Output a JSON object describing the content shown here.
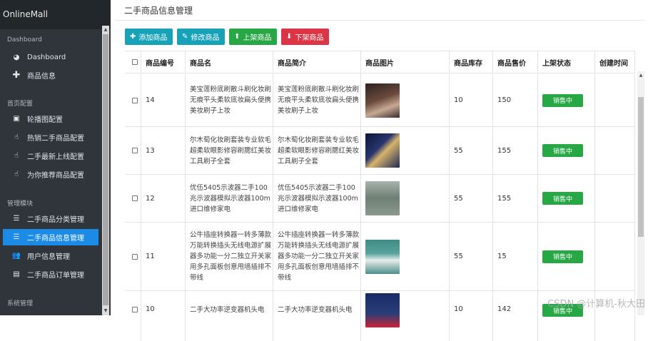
{
  "app": {
    "title": "OnlineMall"
  },
  "sidebar": {
    "sections": [
      {
        "label": "Dashboard"
      },
      {
        "label": "首页配置"
      },
      {
        "label": "管理模块"
      },
      {
        "label": "系统管理"
      }
    ],
    "items": [
      {
        "label": "Dashboard",
        "icon": "dashboard-icon"
      },
      {
        "label": "商品信息",
        "icon": "plus-icon"
      },
      {
        "label": "轮播图配置",
        "icon": "image-icon"
      },
      {
        "label": "热销二手商品配置",
        "icon": "pointer-icon"
      },
      {
        "label": "二手最新上线配置",
        "icon": "pointer-icon"
      },
      {
        "label": "为你推荐商品配置",
        "icon": "pointer-icon"
      },
      {
        "label": "二手商品分类管理",
        "icon": "list-icon"
      },
      {
        "label": "二手商品信息管理",
        "icon": "list-icon"
      },
      {
        "label": "用户信息管理",
        "icon": "users-icon"
      },
      {
        "label": "二手商品订单管理",
        "icon": "order-icon"
      }
    ]
  },
  "main": {
    "title": "二手商品信息管理",
    "toolbar": {
      "add": "添加商品",
      "edit": "修改商品",
      "up": "上架商品",
      "down": "下架商品"
    },
    "table": {
      "headers": [
        "商品编号",
        "商品名",
        "商品简介",
        "商品图片",
        "商品库存",
        "商品售价",
        "上架状态",
        "创建时间"
      ],
      "rows": [
        {
          "id": "14",
          "name": "美宝莲粉底刷散斗刷化妆刷无痕平头柔软底妆扁头便携美妆刷子上妆",
          "intro": "美宝莲粉底刷散斗刷化妆刷无痕平头柔软底妆扁头便携美妆刷子上妆",
          "stock": "10",
          "price": "150",
          "status": "销售中",
          "img": "#3a2d2a"
        },
        {
          "id": "13",
          "name": "尔木萄化妆刷套装专业软毛超柔软眼影修容刷腮红美妆工具刷子全套",
          "intro": "尔木萄化妆刷套装专业软毛超柔软眼影修容刷腮红美妆工具刷子全套",
          "stock": "55",
          "price": "155",
          "status": "销售中",
          "img": "#1f2a57"
        },
        {
          "id": "12",
          "name": "优伍5405示波器二手100兆示波器模拟示波器100m进口维修家电",
          "intro": "优伍5405示波器二手100兆示波器模拟示波器100m进口维修家电",
          "stock": "55",
          "price": "155",
          "status": "销售中",
          "img": "#7d8c80"
        },
        {
          "id": "11",
          "name": "公牛插座转换器一转多薄款万能转换插头无线电源扩展器多功能一分二独立开关家用多孔面板创意甩墙插排不带线",
          "intro": "公牛插座转换器一转多薄款万能转换插头无线电源扩展器多功能一分二独立开关家用多孔面板创意甩墙插排不带线",
          "stock": "55",
          "price": "15",
          "status": "销售中",
          "img": "#4d8f8a"
        },
        {
          "id": "10",
          "name": "二手大功率逆变器机头电",
          "intro": "二手大功率逆变器机头电",
          "stock": "10",
          "price": "142",
          "status": "销售中",
          "img": "#2a3e7a"
        }
      ]
    }
  },
  "watermark": "CSDN @计算机-秋大田"
}
